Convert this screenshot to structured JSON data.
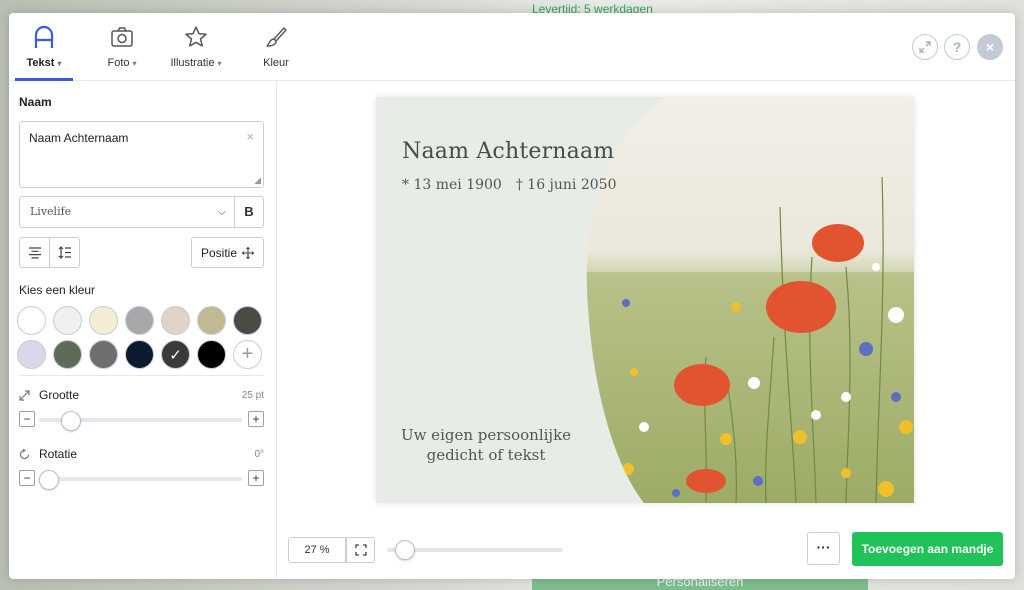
{
  "background": {
    "delivery_text": "Levertijd: 5 werkdagen",
    "personalize_button": "Personaliseren"
  },
  "tabs": [
    {
      "label": "Tekst",
      "icon": "letter-a-icon",
      "active": true,
      "has_dropdown": true
    },
    {
      "label": "Foto",
      "icon": "camera-icon",
      "active": false,
      "has_dropdown": true
    },
    {
      "label": "Illustratie",
      "icon": "star-icon",
      "active": false,
      "has_dropdown": true
    },
    {
      "label": "Kleur",
      "icon": "brush-icon",
      "active": false,
      "has_dropdown": false
    }
  ],
  "top_controls": {
    "expand_icon": "expand-icon",
    "help_label": "?",
    "close_label": "×"
  },
  "text_panel": {
    "name_label": "Naam",
    "name_value": "Naam Achternaam",
    "clear_label": "×",
    "font_value": "Livelife",
    "bold_label": "B",
    "position_label": "Positie",
    "color_label": "Kies een kleur",
    "colors": [
      "#ffffff",
      "#eef0f2",
      "#f5ecd4",
      "#a7a8aa",
      "#e2d2c8",
      "#c2b892",
      "#4b4a43",
      "#d9d8ea",
      "#5e6b59",
      "#6e6e6e",
      "#0b1a2e",
      "#3a3a3a",
      "#000000"
    ],
    "selected_color": "#3a3a3a",
    "checkmark": "✓",
    "add_color_label": "+",
    "size_label": "Grootte",
    "size_value": "25 pt",
    "size_fraction": 0.12,
    "rotation_label": "Rotatie",
    "rotation_value": "0°",
    "rotation_fraction": 0.0,
    "minus_label": "−",
    "plus_label": "+"
  },
  "card": {
    "name": "Naam Achternaam",
    "birth": "* 13 mei 1900",
    "death": "† 16 juni 2050",
    "poem_line1": "Uw eigen persoonlijke",
    "poem_line2": "gedicht of tekst",
    "background_color": "#e7ece6",
    "text_color": "#4a4a4a"
  },
  "bottom_bar": {
    "zoom_value": "27 %",
    "zoom_fraction": 0.05,
    "more_label": "···",
    "add_to_cart_label": "Toevoegen aan mandje",
    "accent_color": "#22c25a"
  }
}
